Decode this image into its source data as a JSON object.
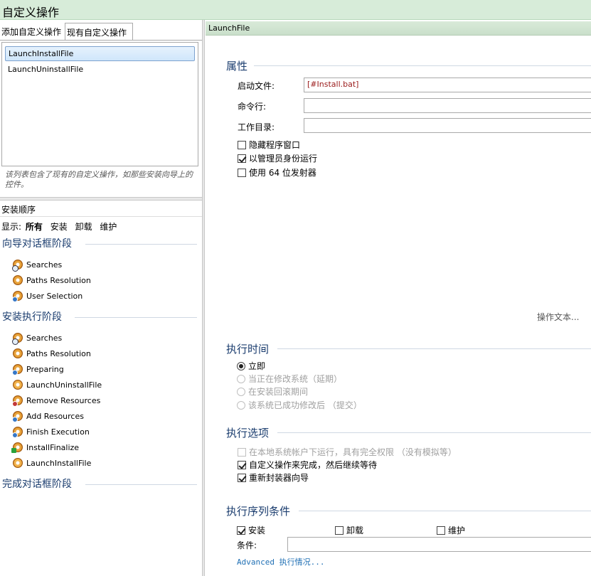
{
  "window": {
    "title": "自定义操作"
  },
  "left": {
    "tabs": [
      {
        "label": "添加自定义操作"
      },
      {
        "label": "现有自定义操作"
      }
    ],
    "actions": [
      {
        "label": "LaunchInstallFile",
        "selected": true
      },
      {
        "label": "LaunchUninstallFile",
        "selected": false
      }
    ],
    "hint": "该列表包含了现有的自定义操作，如那些安装向导上的控件。",
    "sequence_header": "安装顺序",
    "display": {
      "label": "显示:",
      "options": [
        "所有",
        "安装",
        "卸载",
        "维护"
      ]
    },
    "phases": [
      {
        "title": "向导对话框阶段",
        "steps": [
          "Searches",
          "Paths Resolution",
          "User Selection"
        ]
      },
      {
        "title": "安装执行阶段",
        "steps": [
          "Searches",
          "Paths Resolution",
          "Preparing",
          "LaunchUninstallFile",
          "Remove Resources",
          "Add Resources",
          "Finish Execution",
          "InstallFinalize",
          "LaunchInstallFile"
        ]
      },
      {
        "title": "完成对话框阶段",
        "steps": []
      }
    ]
  },
  "right": {
    "header": "LaunchFile",
    "properties": {
      "title": "属性",
      "launch_file_label": "启动文件:",
      "launch_file_value": "[#Install.bat]",
      "command_line_label": "命令行:",
      "command_line_value": "",
      "working_dir_label": "工作目录:",
      "working_dir_value": "",
      "checks": [
        {
          "label": "隐藏程序窗口",
          "checked": false
        },
        {
          "label": "以管理员身份运行",
          "checked": true
        },
        {
          "label": "使用 64 位发射器",
          "checked": false
        }
      ],
      "op_text": "操作文本..."
    },
    "exec_time": {
      "title": "执行时间",
      "options": [
        {
          "label": "立即",
          "selected": true,
          "disabled": false
        },
        {
          "label": "当正在修改系统（延期）",
          "selected": false,
          "disabled": true
        },
        {
          "label": "在安装回滚期间",
          "selected": false,
          "disabled": true
        },
        {
          "label": "该系统已成功修改后 （提交）",
          "selected": false,
          "disabled": true
        }
      ]
    },
    "exec_options": {
      "title": "执行选项",
      "options": [
        {
          "label": "在本地系统帐户下运行，具有完全权限 （没有模拟等）",
          "checked": false,
          "disabled": true
        },
        {
          "label": "自定义操作来完成，然后继续等待",
          "checked": true,
          "disabled": false
        },
        {
          "label": "重新封装器向导",
          "checked": true,
          "disabled": false
        }
      ]
    },
    "exec_conditions": {
      "title": "执行序列条件",
      "checks": [
        {
          "label": "安装",
          "checked": true
        },
        {
          "label": "卸载",
          "checked": false
        },
        {
          "label": "维护",
          "checked": false
        }
      ],
      "condition_label": "条件:",
      "condition_value": "",
      "advanced": "Advanced 执行情况..."
    }
  }
}
